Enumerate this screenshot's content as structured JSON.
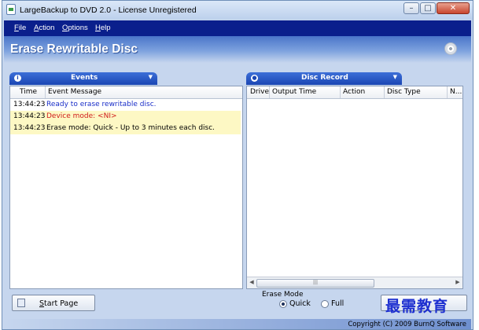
{
  "window": {
    "title": "LargeBackup to DVD 2.0 - License Unregistered",
    "controls": [
      "minimize-icon",
      "maximize-icon",
      "close-icon"
    ]
  },
  "menu": {
    "items": [
      "File",
      "Action",
      "Options",
      "Help"
    ]
  },
  "header": {
    "title": "Erase Rewritable Disc",
    "icon": "disc-icon"
  },
  "events_panel": {
    "tab_label": "Events",
    "columns": [
      "Time",
      "Event Message"
    ],
    "rows": [
      {
        "time": "13:44:23",
        "message": "Ready to erase rewritable disc.",
        "color": "#1a2ec8",
        "highlight": false
      },
      {
        "time": "13:44:23",
        "message": "Device mode: <NI>",
        "color": "#d01a1a",
        "highlight": true
      },
      {
        "time": "13:44:23",
        "message": "Erase mode:  Quick - Up to 3 minutes each disc.",
        "color": "#000000",
        "highlight": true
      }
    ]
  },
  "disc_record_panel": {
    "tab_label": "Disc Record",
    "columns": [
      "Drive",
      "Output Time",
      "Action",
      "Disc Type",
      "N..."
    ]
  },
  "buttons": {
    "start_page": "Start Page"
  },
  "erase_mode": {
    "label": "Erase Mode",
    "options": [
      {
        "label": "Quick",
        "selected": true
      },
      {
        "label": "Full",
        "selected": false
      }
    ]
  },
  "watermark": "最需教育",
  "footer": {
    "copyright": "Copyright (C) 2009 BurnQ Software"
  },
  "colors": {
    "menubar": "#0a1f8c",
    "panel_tab": "#1b46b3",
    "highlight_row": "#fdf8c4"
  }
}
